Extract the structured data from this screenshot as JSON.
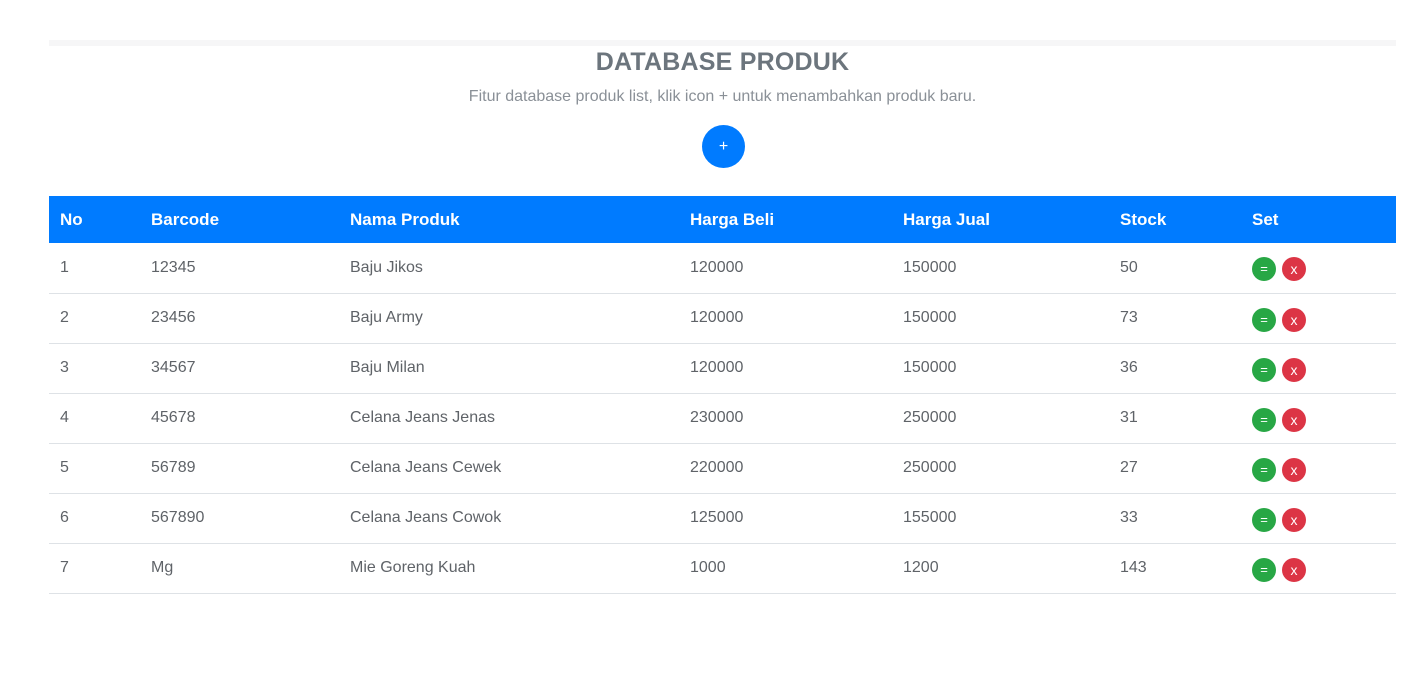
{
  "header": {
    "title": "DATABASE PRODUK",
    "subtitle": "Fitur database produk list, klik icon + untuk menambahkan produk baru.",
    "add_label": "+"
  },
  "table": {
    "columns": [
      "No",
      "Barcode",
      "Nama Produk",
      "Harga Beli",
      "Harga Jual",
      "Stock",
      "Set"
    ],
    "rows": [
      {
        "no": "1",
        "barcode": "12345",
        "nama": "Baju Jikos",
        "beli": "120000",
        "jual": "150000",
        "stock": "50"
      },
      {
        "no": "2",
        "barcode": "23456",
        "nama": "Baju Army",
        "beli": "120000",
        "jual": "150000",
        "stock": "73"
      },
      {
        "no": "3",
        "barcode": "34567",
        "nama": "Baju Milan",
        "beli": "120000",
        "jual": "150000",
        "stock": "36"
      },
      {
        "no": "4",
        "barcode": "45678",
        "nama": "Celana Jeans Jenas",
        "beli": "230000",
        "jual": "250000",
        "stock": "31"
      },
      {
        "no": "5",
        "barcode": "56789",
        "nama": "Celana Jeans Cewek",
        "beli": "220000",
        "jual": "250000",
        "stock": "27"
      },
      {
        "no": "6",
        "barcode": "567890",
        "nama": "Celana Jeans Cowok",
        "beli": "125000",
        "jual": "155000",
        "stock": "33"
      },
      {
        "no": "7",
        "barcode": "Mg",
        "nama": "Mie Goreng Kuah",
        "beli": "1000",
        "jual": "1200",
        "stock": "143"
      }
    ],
    "edit_label": "=",
    "delete_label": "x"
  },
  "colors": {
    "primary": "#007bff",
    "success": "#28a745",
    "danger": "#dc3545"
  }
}
